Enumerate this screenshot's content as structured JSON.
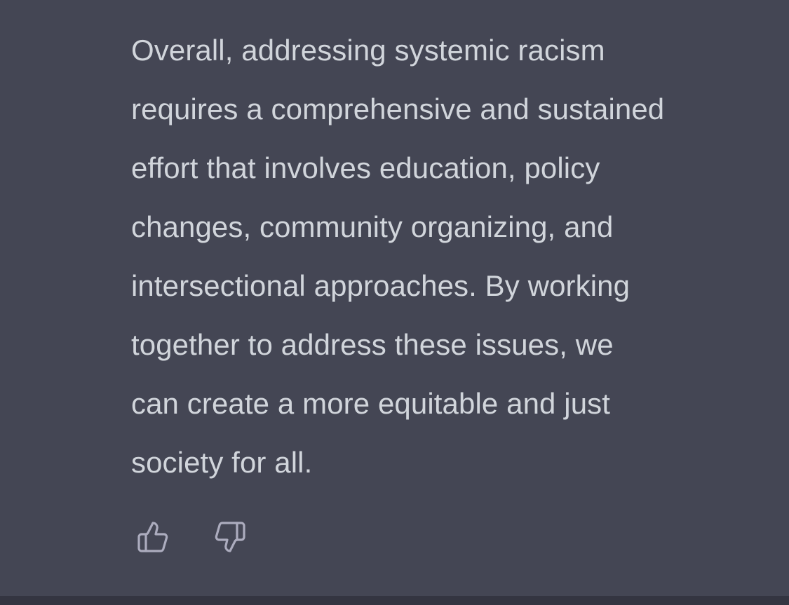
{
  "message": {
    "lines": [
      "Overall, addressing systemic racism",
      "requires a comprehensive and sustained",
      "effort that involves education, policy",
      "changes, community organizing, and",
      "intersectional approaches. By working",
      "together to address these issues, we",
      "can create a more equitable and just",
      "society for all."
    ]
  },
  "feedback": {
    "thumbs_up_icon": "thumbs-up-icon",
    "thumbs_down_icon": "thumbs-down-icon"
  },
  "colors": {
    "background": "#444654",
    "text": "#d1d5db",
    "icon": "#acacbe",
    "bottom_bar": "#343541"
  }
}
